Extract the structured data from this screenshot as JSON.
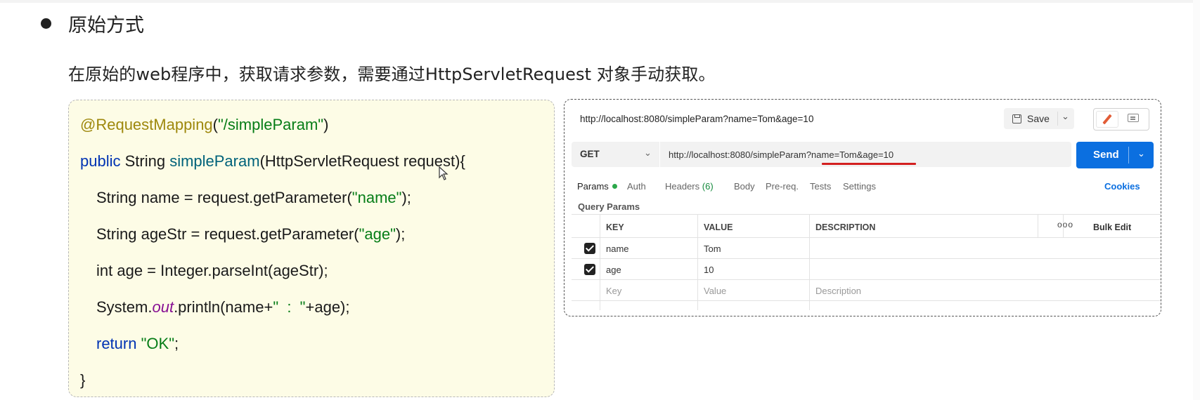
{
  "heading": "原始方式",
  "description": "在原始的web程序中，获取请求参数，需要通过HttpServletRequest 对象手动获取。",
  "code": {
    "l1_annotation": "@RequestMapping",
    "l1_paren_open": "(",
    "l1_string": "\"/simpleParam\"",
    "l1_paren_close": ")",
    "l2_kw": "public",
    "l2_type": " String ",
    "l2_method": "simpleParam",
    "l2_rest": "(HttpServletRequest request){",
    "l3_pre": "String name = request.getParameter(",
    "l3_str": "\"name\"",
    "l3_post": ");",
    "l4_pre": "String ageStr = request.getParameter(",
    "l4_str": "\"age\"",
    "l4_post": ");",
    "l5": "int age = Integer.parseInt(ageStr);",
    "l6_pre": "System.",
    "l6_field": "out",
    "l6_mid": ".println(name+",
    "l6_str": "\"  :  \"",
    "l6_post": "+age);",
    "l7_kw": "return",
    "l7_sp": " ",
    "l7_str": "\"OK\"",
    "l7_post": ";",
    "l8": "}"
  },
  "postman": {
    "title_url": "http://localhost:8080/simpleParam?name=Tom&age=10",
    "save_label": "Save",
    "method": "GET",
    "url": "http://localhost:8080/simpleParam?name=Tom&age=10",
    "send_label": "Send",
    "tabs": {
      "params": "Params",
      "auth": "Auth",
      "headers": "Headers",
      "headers_count": "(6)",
      "body": "Body",
      "prereq": "Pre-req.",
      "tests": "Tests",
      "settings": "Settings"
    },
    "cookies": "Cookies",
    "query_params_label": "Query Params",
    "columns": {
      "key": "KEY",
      "value": "VALUE",
      "description": "DESCRIPTION",
      "more": "ooo",
      "bulk_edit": "Bulk Edit"
    },
    "rows": [
      {
        "key": "name",
        "value": "Tom",
        "checked": true
      },
      {
        "key": "age",
        "value": "10",
        "checked": true
      }
    ],
    "placeholders": {
      "key": "Key",
      "value": "Value",
      "description": "Description"
    }
  },
  "colors": {
    "send": "#0b6fe0",
    "code_bg": "#fdfce6",
    "underline": "#d32020"
  }
}
